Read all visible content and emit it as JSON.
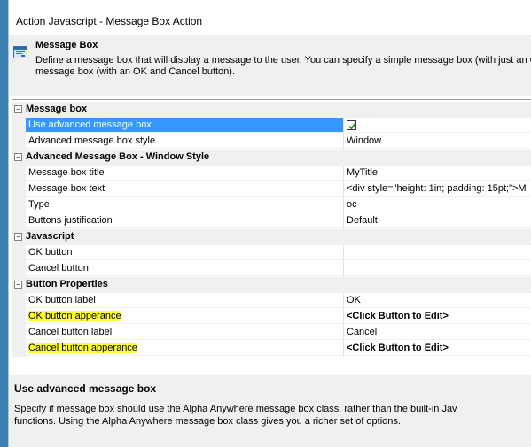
{
  "window": {
    "title": "Action Javascript - Message Box Action"
  },
  "header": {
    "icon": "message-box-icon",
    "title": "Message Box",
    "description_line1": "Define a message box that will display a message to the user. You can specify a simple message box (with just an OK",
    "description_line2": "message box (with an OK and Cancel button)."
  },
  "grid": {
    "categories": [
      {
        "label": "Message box",
        "properties": [
          {
            "name": "Use advanced message box",
            "value": "",
            "checked": true
          },
          {
            "name": "Advanced message box style",
            "value": "Window"
          }
        ]
      },
      {
        "label": "Advanced Message Box - Window Style",
        "properties": [
          {
            "name": "Message box title",
            "value": "MyTitle"
          },
          {
            "name": "Message box text",
            "value": "<div style=\"height: 1in; padding: 15pt;\">M"
          },
          {
            "name": "Type",
            "value": "oc"
          },
          {
            "name": "Buttons justification",
            "value": "Default"
          }
        ]
      },
      {
        "label": "Javascript",
        "properties": [
          {
            "name": "OK button",
            "value": ""
          },
          {
            "name": "Cancel button",
            "value": ""
          }
        ]
      },
      {
        "label": "Button Properties",
        "properties": [
          {
            "name": "OK button label",
            "value": "OK"
          },
          {
            "name": "OK button apperance",
            "value": "<Click Button to Edit>"
          },
          {
            "name": "Cancel button label",
            "value": "Cancel"
          },
          {
            "name": "Cancel button apperance",
            "value": "<Click Button to Edit>"
          }
        ]
      }
    ],
    "collapse_symbol": "−"
  },
  "help": {
    "title": "Use advanced message box",
    "text_line1": "Specify if message box should use the Alpha Anywhere message box class, rather than the built-in Jav",
    "text_line2": "functions. Using the Alpha Anywhere message box class gives you a richer set of options."
  },
  "colors": {
    "selection": "#3399ff",
    "highlight": "#ffff33",
    "window_border": "#3c7fb1"
  }
}
